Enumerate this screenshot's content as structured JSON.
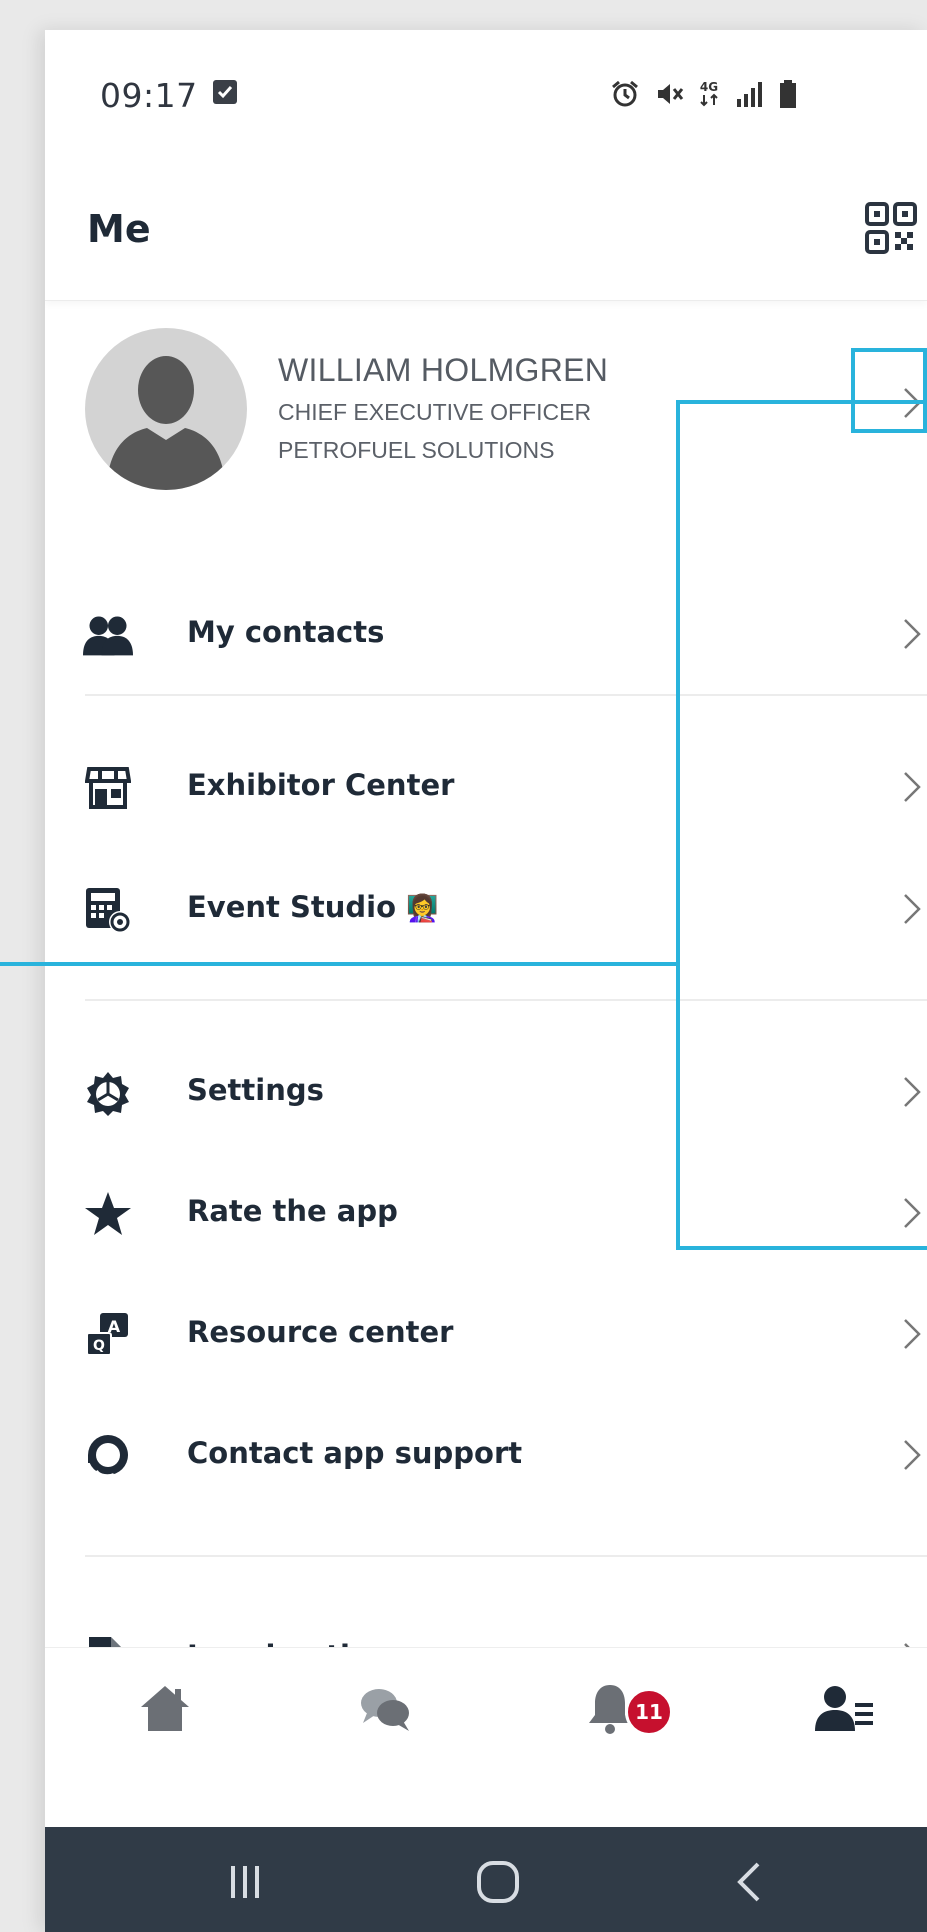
{
  "status_bar": {
    "time": "09:17",
    "network": "4G"
  },
  "header": {
    "title": "Me",
    "qr_icon": "qr-code-icon"
  },
  "profile": {
    "name": "WILLIAM HOLMGREN",
    "role": "CHIEF EXECUTIVE OFFICER",
    "company": "PETROFUEL SOLUTIONS"
  },
  "menu": {
    "contacts": {
      "label": "My contacts",
      "icon": "contacts-icon"
    },
    "exhibitor": {
      "label": "Exhibitor Center",
      "icon": "storefront-icon"
    },
    "event_studio": {
      "label": "Event Studio",
      "emoji": "👩‍🏫",
      "icon": "calculator-gear-icon"
    },
    "settings": {
      "label": "Settings",
      "icon": "gear-icon"
    },
    "rate": {
      "label": "Rate the app",
      "icon": "star-icon"
    },
    "resource": {
      "label": "Resource center",
      "icon": "qa-icon"
    },
    "support": {
      "label": "Contact app support",
      "icon": "headset-icon"
    },
    "legal": {
      "label": "Legal notice",
      "icon": "document-pen-icon"
    }
  },
  "bottom_nav": {
    "notifications_badge": "11",
    "items": [
      "home-icon",
      "chat-icon",
      "bell-icon",
      "profile-menu-icon"
    ]
  },
  "colors": {
    "text_primary": "#1f2a37",
    "annotation": "#29b3dc",
    "badge": "#c6102e",
    "system_nav": "#303b47"
  }
}
